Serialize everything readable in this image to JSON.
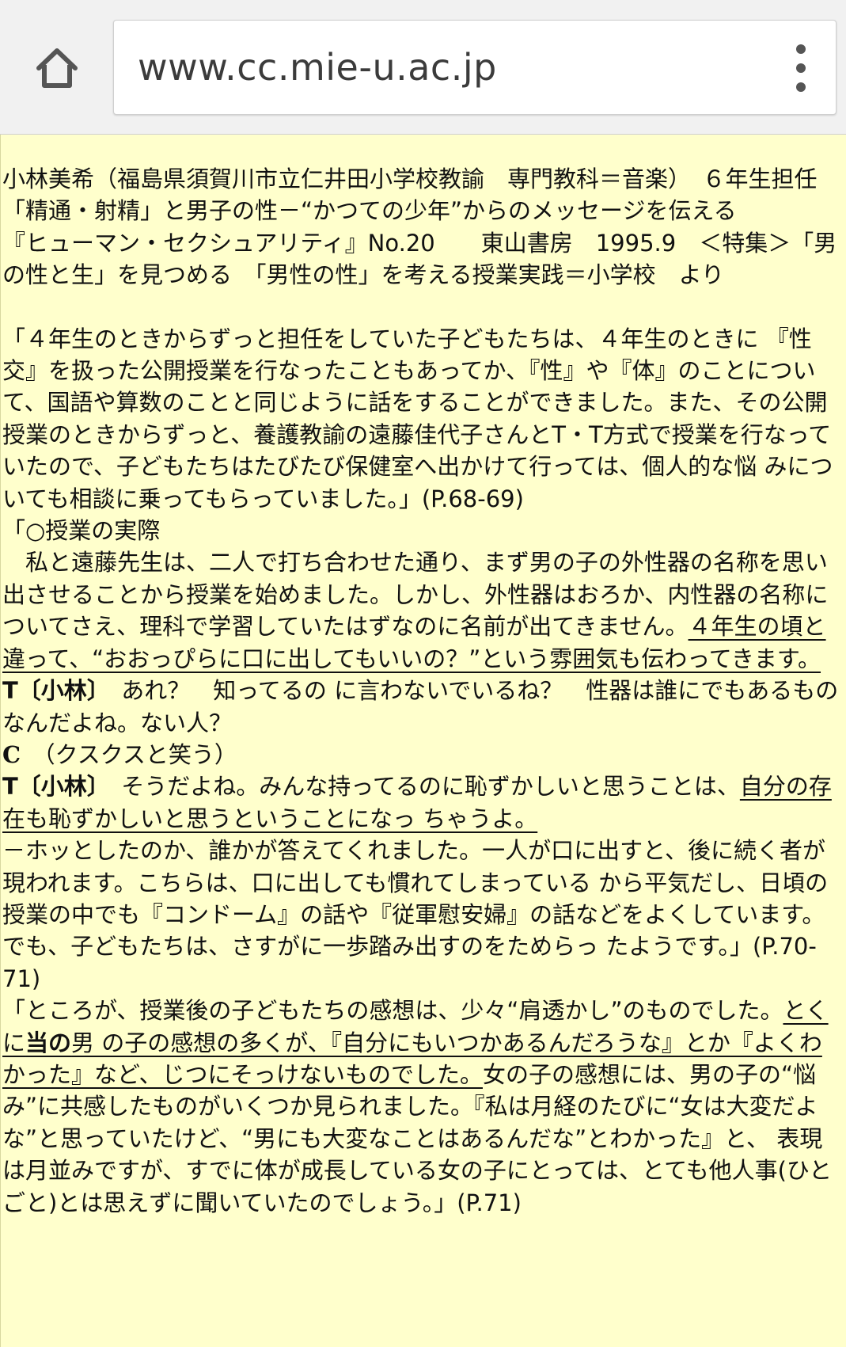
{
  "browser": {
    "url": "www.cc.mie-u.ac.jp",
    "icons": {
      "home": "home-icon",
      "menu": "more-vert-icon"
    }
  },
  "article": {
    "header": [
      "小林美希（福島県須賀川市立仁井田小学校教諭　専門教科＝音楽）　６年生担任",
      "「精通・射精」と男子の性－“かつての少年”からのメッセージを伝える",
      "『ヒューマン・セクシュアリティ』No.20　　東山書房　1995.9　＜特集＞「男の性と生」を見つめる　「男性の性」を考える授業実践＝小学校　より"
    ],
    "p1": "「４年生のときからずっと担任をしていた子どもたちは、４年生のときに 『性交』を扱った公開授業を行なったこともあってか、『性』や『体』のことについて、国語や算数のことと同じように話をすることができました。また、その公開授業のときからずっと、養護教諭の遠藤佳代子さんとT・T方式で授業を行なっていたので、子どもたちはたびたび保健室へ出かけて行っては、個人的な悩 みについても相談に乗ってもらっていました。」(P.68-69)",
    "p2_title": "「○授業の実際",
    "p2_a": "　私と遠藤先生は、二人で打ち合わせた通り、まず男の子の外性器の名称を思い出させることから授業を始めました。しかし、外性器はおろか、内性器の名称に ついてさえ、理科で学習していたはずなのに名前が出てきません。",
    "p2_u": "４年生の頃と違って、“おおっぴらに口に出してもいいの？”という雰囲気も伝わってきます。",
    "t1_speaker": "T〔小林〕",
    "t1_text": "　あれ？　知ってるの に言わないでいるね？　性器は誰にでもあるものなんだよね。ない人？",
    "c_speaker": "C",
    "c_text": "　（クスクスと笑う）",
    "t2_speaker": "T〔小林〕",
    "t2_text": "　そうだよね。みんな持ってるのに恥ずかしいと思うことは、",
    "t2_u": "自分の存在も恥ずかしいと思うということになっ ちゃうよ。",
    "p3": "－ホッとしたのか、誰かが答えてくれました。一人が口に出すと、後に続く者が現われます。こちらは、口に出しても慣れてしまっている から平気だし、日頃の授業の中でも『コンドーム』の話や『従軍慰安婦』の話などをよくしています。でも、子どもたちは、さすがに一歩踏み出すのをためらっ たようです。」(P.70-71)",
    "p4_a": "「ところが、授業後の子どもたちの感想は、少々“肩透かし”のものでした。",
    "p4_u1": "とくに",
    "p4_b": "当の",
    "p4_u2": "男 の子の感想の多くが、『自分にもいつかあるんだろうな』とか『よくわかった』など、じつにそっけないものでした。",
    "p4_c": "女の子の感想には、男の子の“悩 み”に共感したものがいくつか見られました。『私は月経のたびに“女は大変だよな”と思っていたけど、“男にも大変なことはあるんだな”とわかった』と、 表現は月並みですが、すでに体が成長している女の子にとっては、とても他人事(ひとごと)とは思えずに聞いていたのでしょう。」(P.71)"
  }
}
